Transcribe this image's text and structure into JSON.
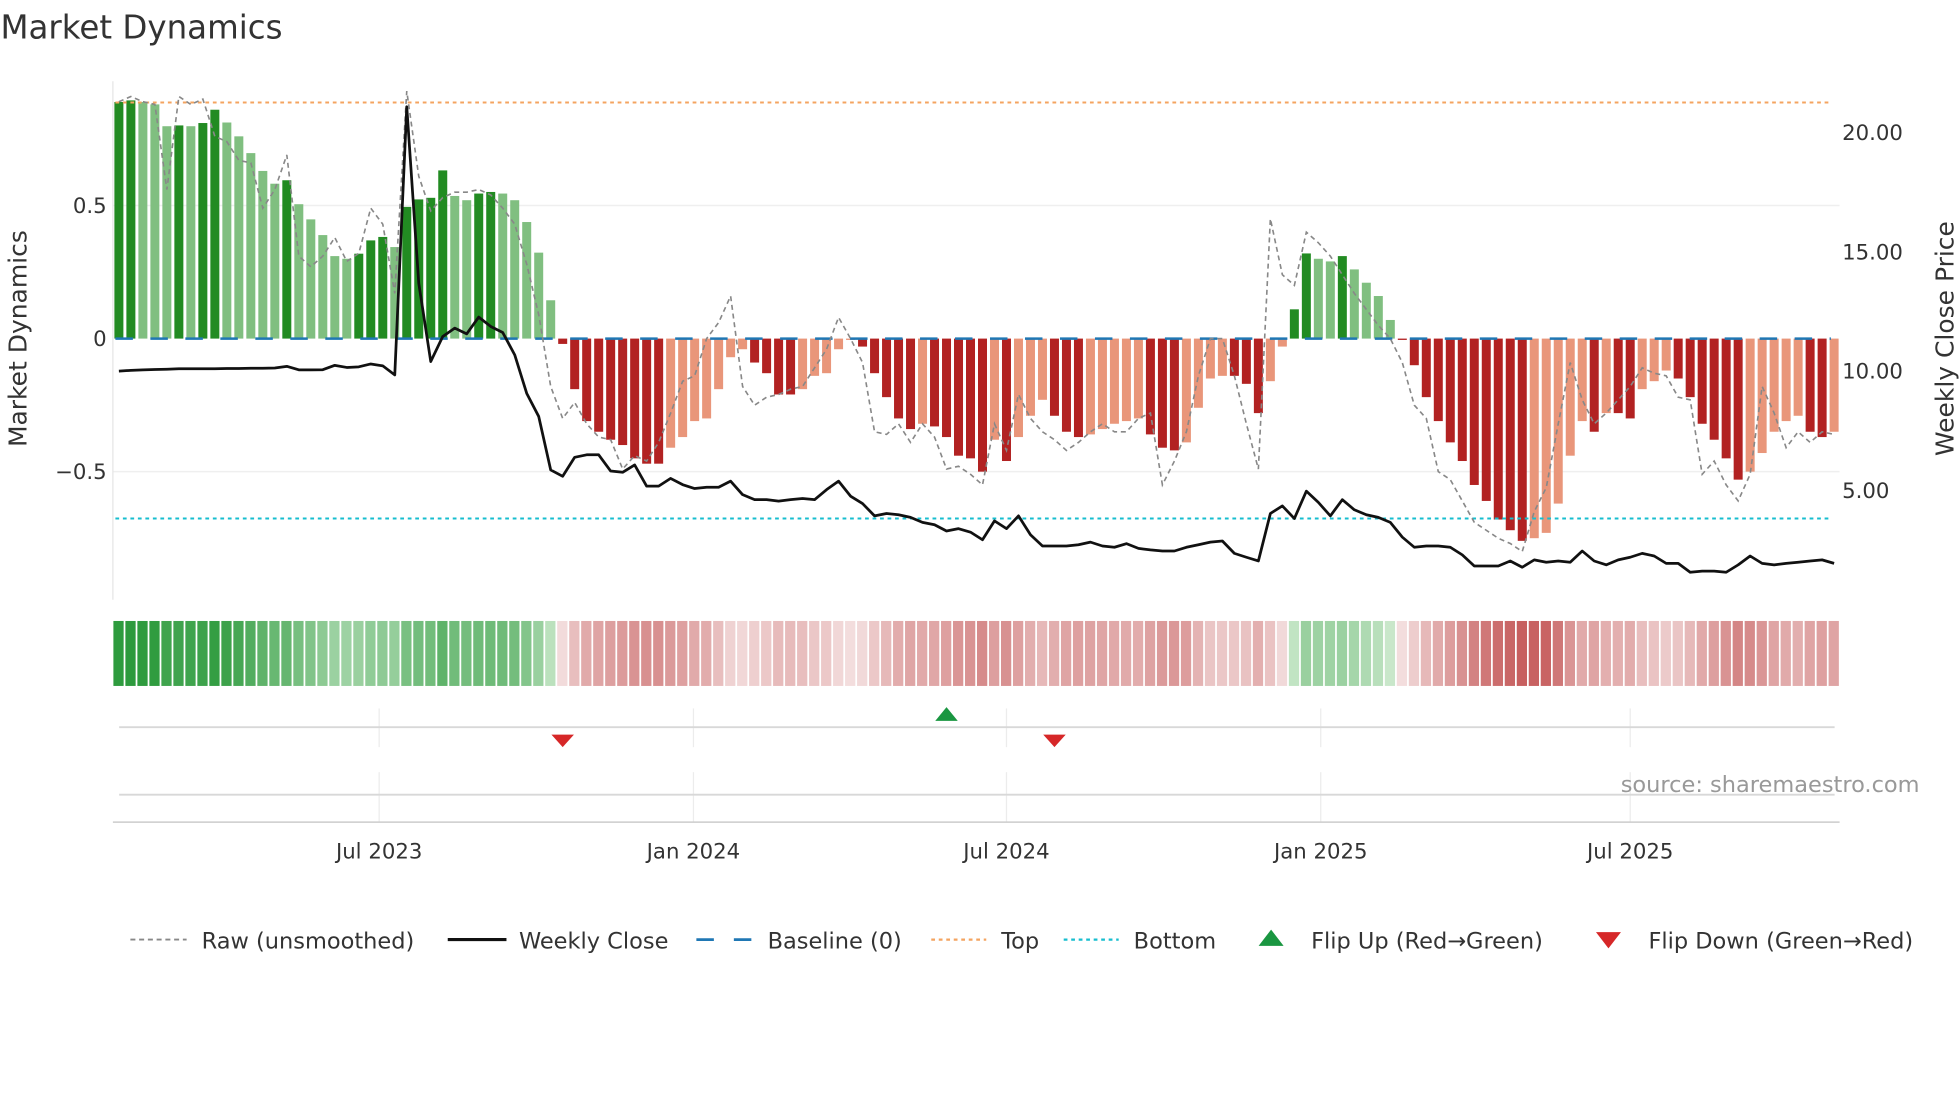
{
  "chart_data": {
    "type": "bar",
    "title": "Market Dynamics",
    "ylabel": "Market Dynamics",
    "y2label": "Weekly Close Price",
    "ylim": [
      -0.98,
      0.97
    ],
    "y2lim": [
      0.8,
      21.9
    ],
    "yticks": [
      {
        "v": 0.5,
        "label": "0.5"
      },
      {
        "v": 0,
        "label": "0"
      },
      {
        "v": -0.5,
        "label": "−0.5"
      }
    ],
    "y2ticks": [
      {
        "v": 20,
        "label": "20.00"
      },
      {
        "v": 15,
        "label": "15.00"
      },
      {
        "v": 10,
        "label": "10.00"
      },
      {
        "v": 5,
        "label": "5.00"
      }
    ],
    "xticks": [
      {
        "week": 21.7,
        "label": "Jul 2023"
      },
      {
        "week": 47.9,
        "label": "Jan 2024"
      },
      {
        "week": 74.0,
        "label": "Jul 2024"
      },
      {
        "week": 100.2,
        "label": "Jan 2025"
      },
      {
        "week": 126.0,
        "label": "Jul 2025"
      }
    ],
    "top_level": 0.887,
    "bottom_level": -0.676,
    "baseline": 0,
    "dynamics": [
      0.889,
      0.895,
      0.889,
      0.88,
      0.798,
      0.801,
      0.798,
      0.81,
      0.86,
      0.812,
      0.76,
      0.697,
      0.63,
      0.582,
      0.595,
      0.505,
      0.448,
      0.389,
      0.31,
      0.3,
      0.319,
      0.369,
      0.382,
      0.344,
      0.495,
      0.523,
      0.529,
      0.632,
      0.536,
      0.52,
      0.545,
      0.551,
      0.545,
      0.52,
      0.438,
      0.323,
      0.144,
      -0.02,
      -0.19,
      -0.31,
      -0.35,
      -0.38,
      -0.4,
      -0.45,
      -0.47,
      -0.47,
      -0.41,
      -0.37,
      -0.31,
      -0.3,
      -0.19,
      -0.07,
      -0.04,
      -0.09,
      -0.13,
      -0.21,
      -0.21,
      -0.19,
      -0.14,
      -0.13,
      -0.04,
      -0.005,
      -0.03,
      -0.13,
      -0.22,
      -0.3,
      -0.34,
      -0.32,
      -0.33,
      -0.37,
      -0.44,
      -0.45,
      -0.5,
      -0.38,
      -0.46,
      -0.37,
      -0.29,
      -0.23,
      -0.29,
      -0.35,
      -0.37,
      -0.36,
      -0.34,
      -0.32,
      -0.31,
      -0.3,
      -0.36,
      -0.41,
      -0.42,
      -0.39,
      -0.26,
      -0.15,
      -0.14,
      -0.14,
      -0.17,
      -0.28,
      -0.16,
      -0.03,
      0.11,
      0.32,
      0.3,
      0.29,
      0.31,
      0.26,
      0.21,
      0.16,
      0.07,
      -0.005,
      -0.1,
      -0.22,
      -0.31,
      -0.39,
      -0.46,
      -0.55,
      -0.61,
      -0.68,
      -0.72,
      -0.76,
      -0.75,
      -0.73,
      -0.62,
      -0.44,
      -0.31,
      -0.35,
      -0.28,
      -0.28,
      -0.3,
      -0.19,
      -0.16,
      -0.12,
      -0.15,
      -0.22,
      -0.32,
      -0.38,
      -0.45,
      -0.53,
      -0.5,
      -0.43,
      -0.35,
      -0.31,
      -0.29,
      -0.35,
      -0.37,
      -0.35
    ],
    "raw": [
      0.89,
      0.91,
      0.89,
      0.88,
      0.56,
      0.91,
      0.88,
      0.9,
      0.76,
      0.74,
      0.67,
      0.66,
      0.49,
      0.56,
      0.69,
      0.31,
      0.27,
      0.31,
      0.38,
      0.29,
      0.32,
      0.49,
      0.43,
      0.17,
      0.93,
      0.61,
      0.48,
      0.53,
      0.55,
      0.55,
      0.56,
      0.54,
      0.49,
      0.43,
      0.28,
      0.09,
      -0.18,
      -0.3,
      -0.24,
      -0.32,
      -0.37,
      -0.38,
      -0.49,
      -0.44,
      -0.46,
      -0.39,
      -0.28,
      -0.16,
      -0.14,
      0.0,
      0.06,
      0.16,
      -0.18,
      -0.25,
      -0.22,
      -0.21,
      -0.19,
      -0.18,
      -0.11,
      -0.04,
      0.08,
      0.0,
      -0.09,
      -0.35,
      -0.36,
      -0.32,
      -0.39,
      -0.32,
      -0.37,
      -0.49,
      -0.48,
      -0.51,
      -0.55,
      -0.32,
      -0.42,
      -0.21,
      -0.3,
      -0.35,
      -0.38,
      -0.42,
      -0.39,
      -0.35,
      -0.32,
      -0.35,
      -0.35,
      -0.3,
      -0.28,
      -0.55,
      -0.46,
      -0.35,
      -0.14,
      0.0,
      0.0,
      -0.14,
      -0.32,
      -0.49,
      0.45,
      0.24,
      0.2,
      0.4,
      0.36,
      0.31,
      0.24,
      0.17,
      0.11,
      0.05,
      0.0,
      -0.09,
      -0.25,
      -0.3,
      -0.5,
      -0.53,
      -0.61,
      -0.69,
      -0.72,
      -0.75,
      -0.77,
      -0.8,
      -0.65,
      -0.56,
      -0.32,
      -0.09,
      -0.23,
      -0.32,
      -0.28,
      -0.23,
      -0.18,
      -0.11,
      -0.13,
      -0.14,
      -0.22,
      -0.23,
      -0.51,
      -0.46,
      -0.55,
      -0.61,
      -0.51,
      -0.18,
      -0.28,
      -0.41,
      -0.35,
      -0.39,
      -0.35,
      -0.36
    ],
    "close": [
      10.0,
      10.03,
      10.05,
      10.07,
      10.08,
      10.1,
      10.1,
      10.1,
      10.1,
      10.11,
      10.11,
      10.12,
      10.12,
      10.13,
      10.2,
      10.05,
      10.05,
      10.06,
      10.24,
      10.15,
      10.18,
      10.3,
      10.22,
      9.84,
      21.08,
      13.68,
      10.4,
      11.45,
      11.8,
      11.56,
      12.26,
      11.87,
      11.62,
      10.68,
      9.07,
      8.1,
      5.86,
      5.59,
      6.39,
      6.49,
      6.49,
      5.81,
      5.76,
      6.07,
      5.18,
      5.18,
      5.5,
      5.24,
      5.08,
      5.13,
      5.13,
      5.39,
      4.82,
      4.61,
      4.61,
      4.55,
      4.61,
      4.66,
      4.61,
      5.03,
      5.39,
      4.76,
      4.45,
      3.93,
      4.03,
      3.98,
      3.87,
      3.66,
      3.56,
      3.3,
      3.4,
      3.25,
      2.93,
      3.72,
      3.4,
      3.93,
      3.14,
      2.67,
      2.67,
      2.67,
      2.72,
      2.83,
      2.67,
      2.62,
      2.77,
      2.57,
      2.51,
      2.46,
      2.46,
      2.62,
      2.72,
      2.83,
      2.88,
      2.36,
      2.2,
      2.04,
      4.03,
      4.35,
      3.82,
      4.97,
      4.5,
      3.93,
      4.61,
      4.19,
      3.98,
      3.87,
      3.66,
      3.04,
      2.62,
      2.67,
      2.67,
      2.62,
      2.3,
      1.83,
      1.83,
      1.83,
      2.04,
      1.78,
      2.09,
      1.99,
      2.04,
      1.99,
      2.46,
      2.04,
      1.88,
      2.09,
      2.2,
      2.36,
      2.25,
      1.94,
      1.94,
      1.57,
      1.62,
      1.62,
      1.57,
      1.88,
      2.25,
      1.94,
      1.88,
      1.94,
      1.99,
      2.04,
      2.09,
      1.94
    ],
    "flips_up": [
      69
    ],
    "flips_down": [
      37,
      78
    ],
    "legend": [
      {
        "key": "raw",
        "label": "Raw (unsmoothed)"
      },
      {
        "key": "close",
        "label": "Weekly Close"
      },
      {
        "key": "baseline",
        "label": "Baseline (0)"
      },
      {
        "key": "top",
        "label": "Top"
      },
      {
        "key": "bottom",
        "label": "Bottom"
      },
      {
        "key": "flip_up",
        "label": "Flip Up (Red→Green)"
      },
      {
        "key": "flip_down",
        "label": "Flip Down (Green→Red)"
      }
    ],
    "legend_placement": "bottom",
    "source": "source: sharemaestro.com"
  },
  "colors": {
    "green_dark": "#228b22",
    "green_light": "#80bf80",
    "red_dark": "#b22222",
    "red_light": "#e9967a",
    "baseline": "#1f77b4",
    "top": "#f4a460",
    "bottom": "#17becf",
    "raw": "#888888",
    "close": "#111111",
    "flip_up": "#1a9641",
    "flip_down": "#d62728"
  }
}
